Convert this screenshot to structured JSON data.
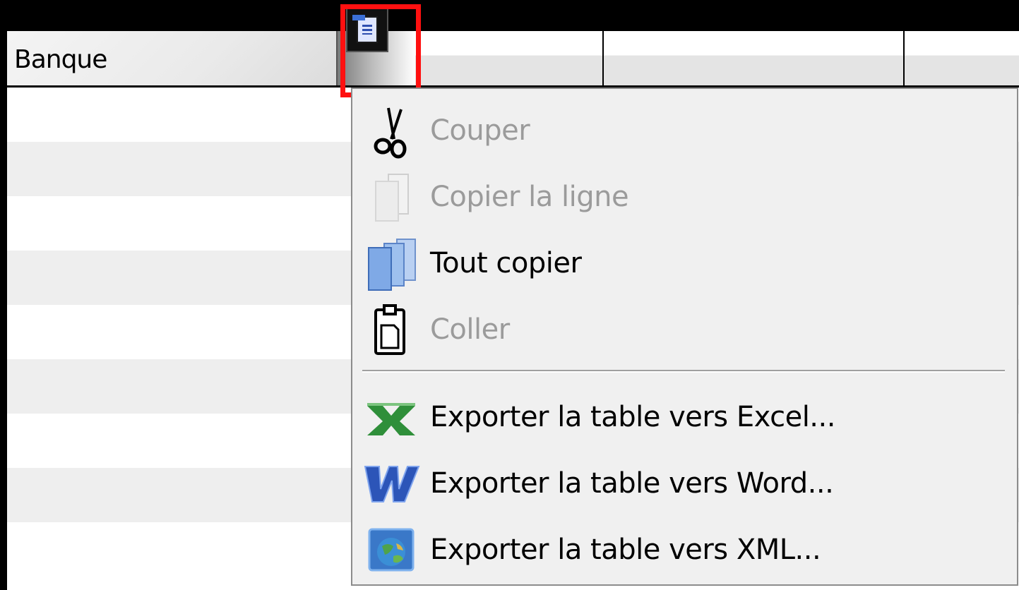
{
  "table": {
    "columns": [
      {
        "label": "Banque"
      },
      {
        "label": ""
      },
      {
        "label": ""
      },
      {
        "label": ""
      }
    ],
    "row_count": 9
  },
  "column_menu_button": {
    "highlighted": true,
    "icon": "column-menu-icon",
    "highlight_color": "#ff1010"
  },
  "context_menu": {
    "items": [
      {
        "label": "Couper",
        "icon": "scissors-icon",
        "enabled": false
      },
      {
        "label": "Copier la ligne",
        "icon": "copy-row-icon",
        "enabled": false
      },
      {
        "label": "Tout copier",
        "icon": "copy-all-icon",
        "enabled": true
      },
      {
        "label": "Coller",
        "icon": "paste-icon",
        "enabled": false
      },
      {
        "label": "Exporter la table vers Excel...",
        "icon": "excel-icon",
        "enabled": true
      },
      {
        "label": "Exporter la table vers Word...",
        "icon": "word-icon",
        "enabled": true
      },
      {
        "label": "Exporter la table vers XML...",
        "icon": "xml-globe-icon",
        "enabled": true
      }
    ]
  },
  "colors": {
    "disabled_text": "#9b9b9b",
    "row_alt": "#eeeeee",
    "menu_bg": "#f0f0f0"
  }
}
